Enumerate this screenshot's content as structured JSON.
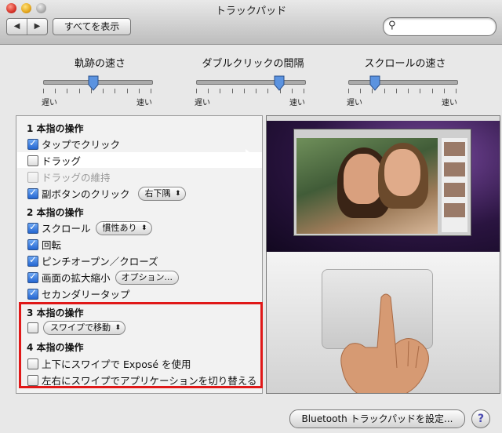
{
  "window": {
    "title": "トラックパッド"
  },
  "toolbar": {
    "back": "◀",
    "forward": "▶",
    "show_all": "すべてを表示",
    "search_placeholder": ""
  },
  "sliders": [
    {
      "label": "軌跡の速さ",
      "min_label": "遅い",
      "max_label": "速い",
      "value": 0.45
    },
    {
      "label": "ダブルクリックの間隔",
      "min_label": "遅い",
      "max_label": "速い",
      "value": 0.77
    },
    {
      "label": "スクロールの速さ",
      "min_label": "遅い",
      "max_label": "速い",
      "value": 0.25
    }
  ],
  "sections": {
    "one_finger": {
      "title": "1 本指の操作",
      "tap_click": "タップでクリック",
      "drag": "ドラッグ",
      "drag_lock": "ドラッグの維持",
      "secondary_click": "副ボタンのクリック",
      "secondary_click_value": "右下隅"
    },
    "two_finger": {
      "title": "2 本指の操作",
      "scroll": "スクロール",
      "scroll_value": "慣性あり",
      "rotate": "回転",
      "pinch": "ピンチオープン／クローズ",
      "zoom": "画面の拡大縮小",
      "zoom_options": "オプション...",
      "secondary_tap": "セカンダリータップ"
    },
    "three_finger": {
      "title": "3 本指の操作",
      "swipe_value": "スワイプで移動"
    },
    "four_finger": {
      "title": "4 本指の操作",
      "expose": "上下にスワイプで Exposé を使用",
      "app_switch": "左右にスワイプでアプリケーションを切り替える"
    }
  },
  "footer": {
    "bluetooth_button": "Bluetooth トラックパッドを設定...",
    "help": "?"
  },
  "colors": {
    "highlight_box": "#e01818",
    "checkbox_on": "#2466d0"
  }
}
